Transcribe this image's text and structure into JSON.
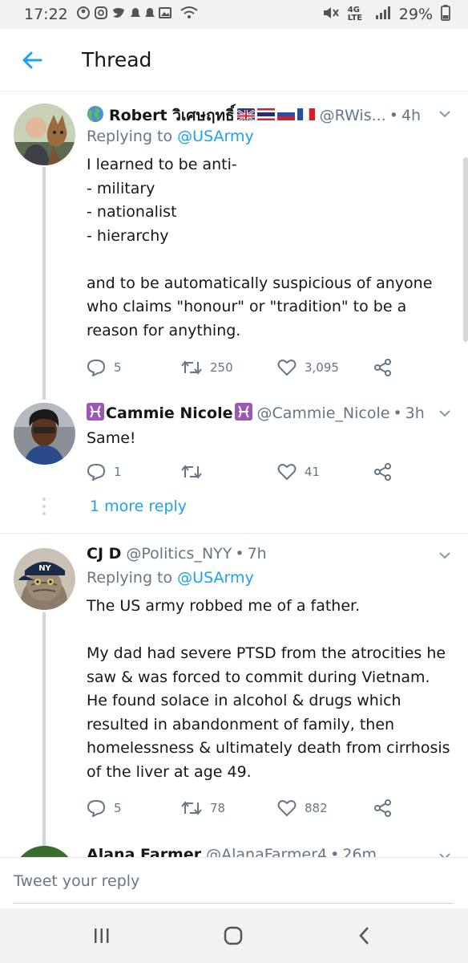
{
  "status_bar": {
    "time": "17:22",
    "battery": "29%",
    "network": "4G LTE"
  },
  "header": {
    "title": "Thread",
    "back_icon": "arrow-left-icon"
  },
  "tweets": [
    {
      "name": "Robert วิเศษฤทธิ์",
      "flags": [
        "uk",
        "thailand",
        "russia",
        "france"
      ],
      "handle": "@RWis...",
      "time": "4h",
      "replying_prefix": "Replying to",
      "replying_to": "@USArmy",
      "text": "I learned to be anti-\n- military\n- nationalist\n- hierarchy\n\nand to be automatically suspicious of anyone who claims \"honour\" or \"tradition\" to be a reason for anything.",
      "replies": "5",
      "retweets": "250",
      "likes": "3,095"
    },
    {
      "name": "Cammie Nicole",
      "handle": "@Cammie_Nicole",
      "time": "3h",
      "text": "Same!",
      "replies": "1",
      "retweets": "",
      "likes": "41"
    },
    {
      "name": "CJ D",
      "handle": "@Politics_NYY",
      "time": "7h",
      "replying_prefix": "Replying to",
      "replying_to": "@USArmy",
      "text": "The US army robbed me of a father.\n\nMy dad had severe PTSD from the atrocities he saw & was forced to commit during Vietnam. He found solace in alcohol & drugs which resulted in abandonment of family, then homelessness & ultimately death from cirrhosis of the liver at age 49.",
      "replies": "5",
      "retweets": "78",
      "likes": "882"
    },
    {
      "name": "Alana Farmer",
      "handle": "@AlanaFarmer4",
      "time": "26m"
    }
  ],
  "more_replies": "1 more reply",
  "composer": {
    "placeholder": "Tweet your reply"
  },
  "colors": {
    "accent": "#1da1f2",
    "secondary_text": "#657786",
    "divider": "#e6ecf0"
  }
}
